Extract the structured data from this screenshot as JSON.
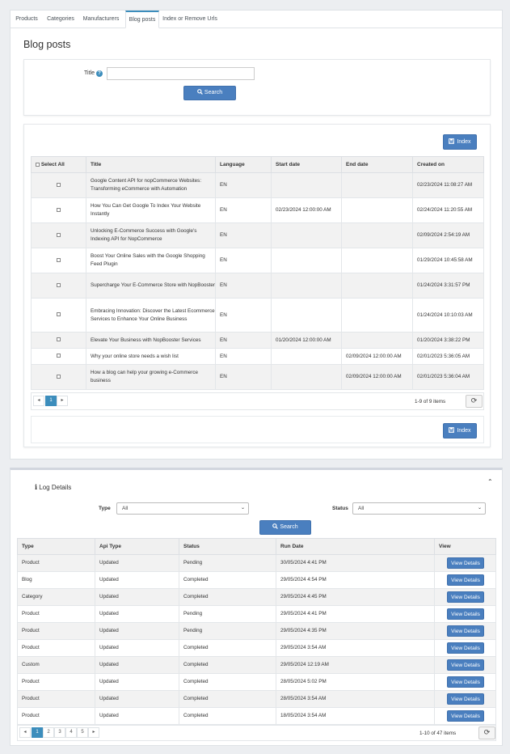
{
  "tabs": [
    {
      "label": "Products",
      "active": false
    },
    {
      "label": "Categories",
      "active": false
    },
    {
      "label": "Manufacturers",
      "active": false
    },
    {
      "label": "Blog posts",
      "active": true
    },
    {
      "label": "Index or Remove Urls",
      "active": false
    }
  ],
  "page_title": "Blog posts",
  "search": {
    "title_label": "Title",
    "title_value": "",
    "button_label": "Search"
  },
  "grid": {
    "index_button_label": "Index",
    "columns": [
      "Select All",
      "Title",
      "Language",
      "Start date",
      "End date",
      "Created on"
    ],
    "rows": [
      {
        "title": "Google Content API for nopCommerce Websites: Transforming eCommerce with Automation",
        "language": "EN",
        "start": "",
        "end": "",
        "created": "02/23/2024 11:08:27 AM"
      },
      {
        "title": "How You Can Get Google To Index Your Website Instantly",
        "language": "EN",
        "start": "02/23/2024 12:00:00 AM",
        "end": "",
        "created": "02/24/2024 11:20:55 AM"
      },
      {
        "title": "Unlocking E-Commerce Success with Google's Indexing API for NopCommerce",
        "language": "EN",
        "start": "",
        "end": "",
        "created": "02/09/2024 2:54:19 AM"
      },
      {
        "title": "Boost Your Online Sales with the Google Shopping Feed Plugin",
        "language": "EN",
        "start": "",
        "end": "",
        "created": "01/29/2024 10:45:58 AM"
      },
      {
        "title": "Supercharge Your E-Commerce Store with NopBooster",
        "language": "EN",
        "start": "",
        "end": "",
        "created": "01/24/2024 3:31:57 PM"
      },
      {
        "title": "Embracing Innovation: Discover the Latest Ecommerce Services to Enhance Your Online Business",
        "language": "EN",
        "start": "",
        "end": "",
        "created": "01/24/2024 10:10:03 AM"
      },
      {
        "title": "Elevate Your Business with NopBooster Services",
        "language": "EN",
        "start": "01/20/2024 12:00:00 AM",
        "end": "",
        "created": "01/20/2024 3:38:22 PM"
      },
      {
        "title": "Why your online store needs a wish list",
        "language": "EN",
        "start": "",
        "end": "02/09/2024 12:00:00 AM",
        "created": "02/01/2023 5:36:05 AM"
      },
      {
        "title": "How a blog can help your growing e-Commerce business",
        "language": "EN",
        "start": "",
        "end": "02/09/2024 12:00:00 AM",
        "created": "02/01/2023 5:36:04 AM"
      }
    ],
    "pager": {
      "prev": "◂",
      "pages": [
        "1"
      ],
      "current": "1",
      "next": "▸",
      "summary": "1-9 of 9 items"
    },
    "footer_index_label": "Index"
  },
  "log": {
    "title": "Log Details",
    "type_label": "Type",
    "type_value": "All",
    "status_label": "Status",
    "status_value": "All",
    "search_label": "Search",
    "columns": [
      "Type",
      "Api Type",
      "Status",
      "Run Date",
      "View"
    ],
    "view_label": "View Details",
    "rows": [
      {
        "type": "Product",
        "api": "Updated",
        "status": "Pending",
        "date": "30/05/2024 4:41 PM"
      },
      {
        "type": "Blog",
        "api": "Updated",
        "status": "Completed",
        "date": "29/05/2024 4:54 PM"
      },
      {
        "type": "Category",
        "api": "Updated",
        "status": "Completed",
        "date": "29/05/2024 4:45 PM"
      },
      {
        "type": "Product",
        "api": "Updated",
        "status": "Pending",
        "date": "29/05/2024 4:41 PM"
      },
      {
        "type": "Product",
        "api": "Updated",
        "status": "Pending",
        "date": "29/05/2024 4:35 PM"
      },
      {
        "type": "Product",
        "api": "Updated",
        "status": "Completed",
        "date": "29/05/2024 3:54 AM"
      },
      {
        "type": "Custom",
        "api": "Updated",
        "status": "Completed",
        "date": "29/05/2024 12:19 AM"
      },
      {
        "type": "Product",
        "api": "Updated",
        "status": "Completed",
        "date": "28/05/2024 5:02 PM"
      },
      {
        "type": "Product",
        "api": "Updated",
        "status": "Completed",
        "date": "28/05/2024 3:54 AM"
      },
      {
        "type": "Product",
        "api": "Updated",
        "status": "Completed",
        "date": "18/05/2024 3:54 AM"
      }
    ],
    "pager": {
      "prev": "◂",
      "pages": [
        "1",
        "2",
        "3",
        "4",
        "5"
      ],
      "current": "1",
      "next": "▸",
      "summary": "1-10 of 47 items"
    }
  },
  "colors": {
    "accent": "#3c8dbc",
    "button": "#4a7fbf"
  },
  "icons": {
    "help": "help-circle-icon",
    "search": "search-icon",
    "save": "floppy-disk-icon",
    "refresh": "refresh-icon",
    "info": "info-icon",
    "collapse": "chevron-up-icon"
  }
}
